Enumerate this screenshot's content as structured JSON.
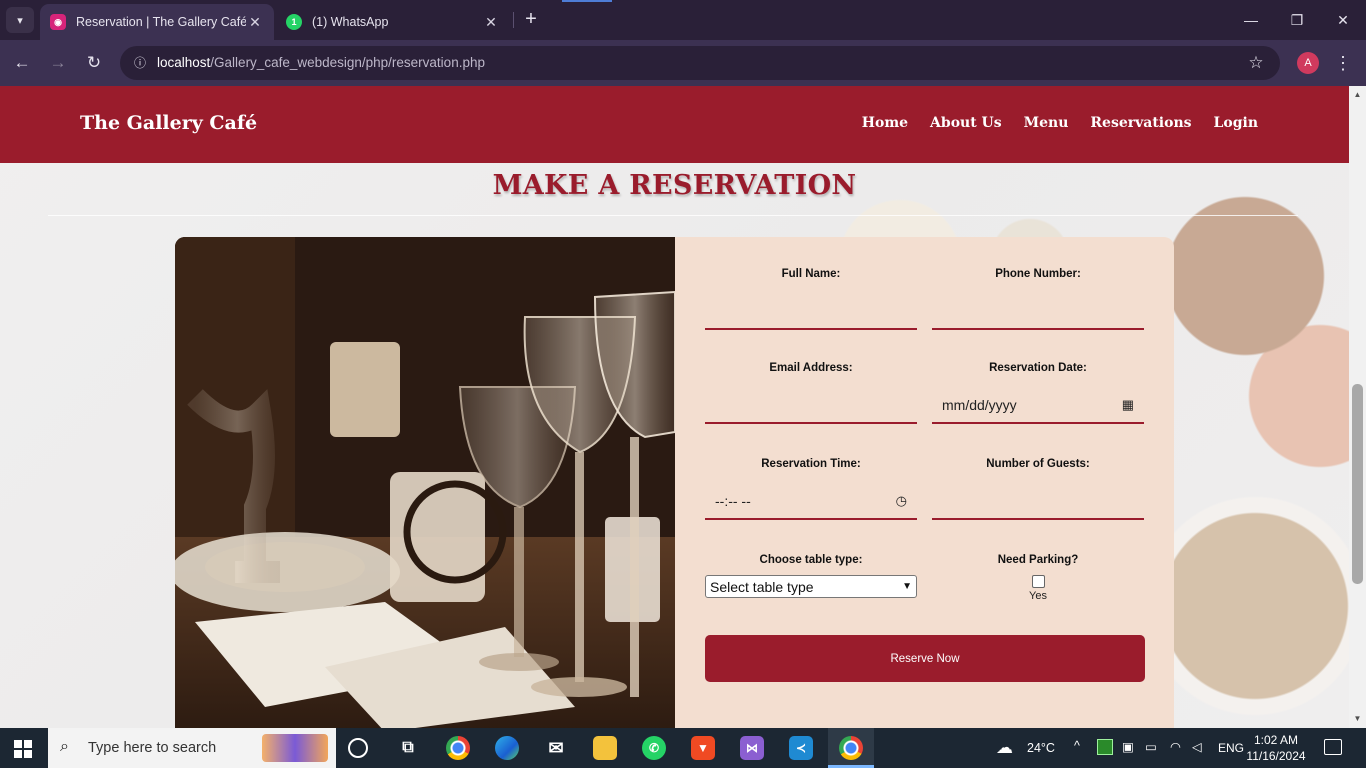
{
  "browser": {
    "tabs": [
      {
        "title": "Reservation | The Gallery Café",
        "active": true
      },
      {
        "title": "(1) WhatsApp",
        "active": false,
        "badge": "1"
      }
    ],
    "url_host": "localhost",
    "url_path": "/Gallery_cafe_webdesign/php/reservation.php",
    "profile_initial": "A"
  },
  "site": {
    "brand": "The Gallery Café",
    "nav": [
      "Home",
      "About Us",
      "Menu",
      "Reservations",
      "Login"
    ],
    "page_title": "MAKE A RESERVATION",
    "accent_color": "#9a1c2c"
  },
  "form": {
    "full_name_label": "Full Name:",
    "phone_label": "Phone Number:",
    "email_label": "Email Address:",
    "date_label": "Reservation Date:",
    "date_value": "mm/dd/yyyy",
    "time_label": "Reservation Time:",
    "time_value": "--:-- --",
    "guests_label": "Number of Guests:",
    "table_label": "Choose table type:",
    "table_selected": "Select table type",
    "parking_label": "Need Parking?",
    "parking_option": "Yes",
    "submit_label": "Reserve Now"
  },
  "taskbar": {
    "search_placeholder": "Type here to search",
    "temperature": "24°C",
    "language": "ENG",
    "time": "1:02 AM",
    "date": "11/16/2024"
  }
}
